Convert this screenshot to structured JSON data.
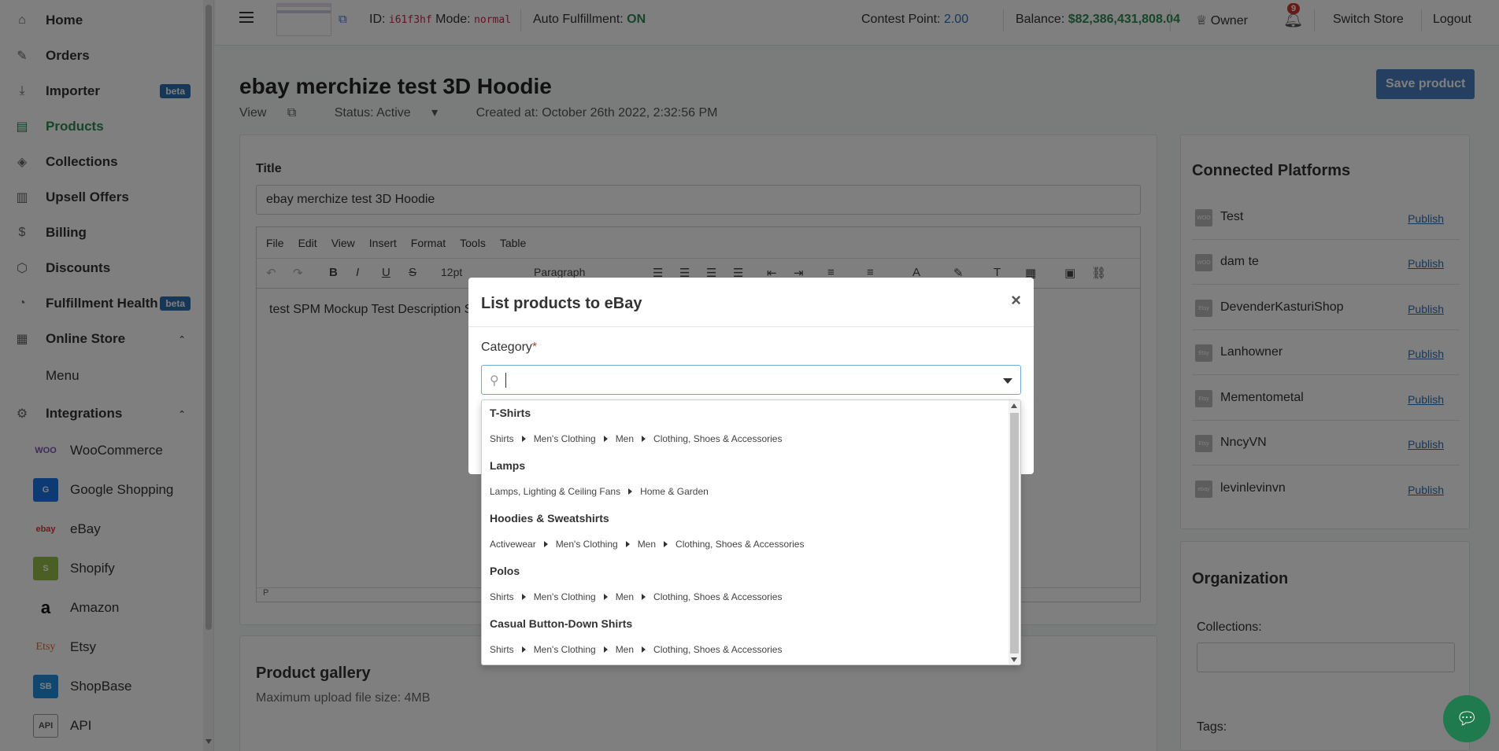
{
  "sidebar": {
    "items": [
      {
        "label": "Home",
        "icon": "home-icon"
      },
      {
        "label": "Orders",
        "icon": "edit-icon"
      },
      {
        "label": "Importer",
        "icon": "download-icon",
        "badge": "beta"
      },
      {
        "label": "Products",
        "icon": "box-icon"
      },
      {
        "label": "Collections",
        "icon": "cube-icon"
      },
      {
        "label": "Upsell Offers",
        "icon": "book-icon"
      },
      {
        "label": "Billing",
        "icon": "dollar-icon"
      },
      {
        "label": "Discounts",
        "icon": "tag-icon"
      },
      {
        "label": "Fulfillment Health",
        "icon": "pie-chart-icon",
        "badge": "beta"
      },
      {
        "label": "Online Store",
        "icon": "store-icon"
      },
      {
        "label": "Menu"
      },
      {
        "label": "Integrations",
        "icon": "plug-icon"
      }
    ],
    "integrations": [
      {
        "label": "WooCommerce",
        "logo": "WOO"
      },
      {
        "label": "Google Shopping",
        "logo": "G"
      },
      {
        "label": "eBay",
        "logo": "ebay"
      },
      {
        "label": "Shopify",
        "logo": "S"
      },
      {
        "label": "Amazon",
        "logo": "a"
      },
      {
        "label": "Etsy",
        "logo": "Etsy"
      },
      {
        "label": "ShopBase",
        "logo": "SB"
      },
      {
        "label": "API",
        "logo": "API"
      }
    ]
  },
  "topbar": {
    "id_label": "ID:",
    "id_value": "i61f3hf",
    "mode_label": "Mode:",
    "mode_value": "normal",
    "auto_label": "Auto Fulfillment:",
    "auto_value": "ON",
    "contest_label": "Contest Point:",
    "contest_value": "2.00",
    "balance_label": "Balance:",
    "balance_value": "$82,386,431,808.04",
    "owner": "Owner",
    "notif_count": "9",
    "switch_store": "Switch Store",
    "logout": "Logout"
  },
  "page": {
    "title": "ebay merchize test 3D Hoodie",
    "view": "View",
    "status": "Status: Active",
    "created": "Created at: October 26th 2022, 2:32:56 PM",
    "save": "Save product"
  },
  "form": {
    "title_label": "Title",
    "title_value": "ebay merchize test 3D Hoodie",
    "editor_menu": [
      "File",
      "Edit",
      "View",
      "Insert",
      "Format",
      "Tools",
      "Table"
    ],
    "font_size": "12pt",
    "block_format": "Paragraph",
    "body_text": "test SPM Mockup Test Description S",
    "status_path": "P"
  },
  "gallery": {
    "title": "Product gallery",
    "hint": "Maximum upload file size: 4MB"
  },
  "platforms": {
    "title": "Connected Platforms",
    "publish_label": "Publish",
    "items": [
      {
        "name": "Test",
        "logo": "WOO"
      },
      {
        "name": "dam te",
        "logo": "WOO"
      },
      {
        "name": "DevenderKasturiShop",
        "logo": "Etsy"
      },
      {
        "name": "Lanhowner",
        "logo": "Etsy"
      },
      {
        "name": "Mementometal",
        "logo": "Etsy"
      },
      {
        "name": "NncyVN",
        "logo": "Etsy"
      },
      {
        "name": "levinlevinvn",
        "logo": "ebay"
      }
    ]
  },
  "organization": {
    "title": "Organization",
    "collections_label": "Collections:",
    "tags_label": "Tags:"
  },
  "modal": {
    "title": "List products to eBay",
    "close": "×",
    "category_label": "Category",
    "required": "*",
    "search_value": ""
  },
  "categories": [
    {
      "name": "T-Shirts",
      "path": [
        "Shirts",
        "Men's Clothing",
        "Men",
        "Clothing, Shoes & Accessories"
      ]
    },
    {
      "name": "Lamps",
      "path": [
        "Lamps, Lighting & Ceiling Fans",
        "Home & Garden"
      ]
    },
    {
      "name": "Hoodies & Sweatshirts",
      "path": [
        "Activewear",
        "Men's Clothing",
        "Men",
        "Clothing, Shoes & Accessories"
      ]
    },
    {
      "name": "Polos",
      "path": [
        "Shirts",
        "Men's Clothing",
        "Men",
        "Clothing, Shoes & Accessories"
      ]
    },
    {
      "name": "Casual Button-Down Shirts",
      "path": [
        "Shirts",
        "Men's Clothing",
        "Men",
        "Clothing, Shoes & Accessories"
      ]
    }
  ],
  "colors": {
    "accent_green": "#2e8b57",
    "primary_blue": "#4a7fc1",
    "badge_blue": "#2f6fb3",
    "notif_red": "#d0342c"
  }
}
